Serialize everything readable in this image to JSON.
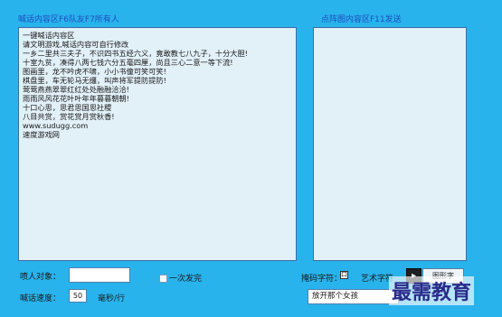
{
  "titles": {
    "left": "喊话内容区F6队友F7所有人",
    "right": "点阵图内容区F11发送"
  },
  "shout_text": [
    "一键喊话内容区",
    "请文明游戏,喊话内容可自行修改",
    "一乡二里共三夫子，不识四书五经六义，竟敢教七八九子，十分大胆!",
    "十室九贫，凑得八两七钱六分五毫四厘，尚且三心二意一等下流!",
    "图画里，龙不吟虎不啸，小小书僮可笑可笑!",
    "棋盘里，车无轮马无缰，叫声将军提防提防!",
    "莺莺燕燕翠翠红红处处融融洽洽!",
    "雨雨风风花花叶叶年年暮暮朝朝!",
    "十口心思，思君思国思社稷",
    "八目共赏，赏花赏月赏秋香!",
    "www.sudugg.com",
    "速度游戏网"
  ],
  "controls": {
    "target_label": "喷人对象：",
    "target_value": "",
    "once_label": "一次发完",
    "speed_label": "喊话速度：",
    "speed_value": "50",
    "speed_unit": "毫秒/行",
    "matrix_label": "掩码字符：",
    "matrix_value": "口",
    "art_label": "艺术字符",
    "arrow": "▸",
    "text_button": "图形字",
    "style_select": "放开那个女孩"
  },
  "watermark": "最需教育"
}
